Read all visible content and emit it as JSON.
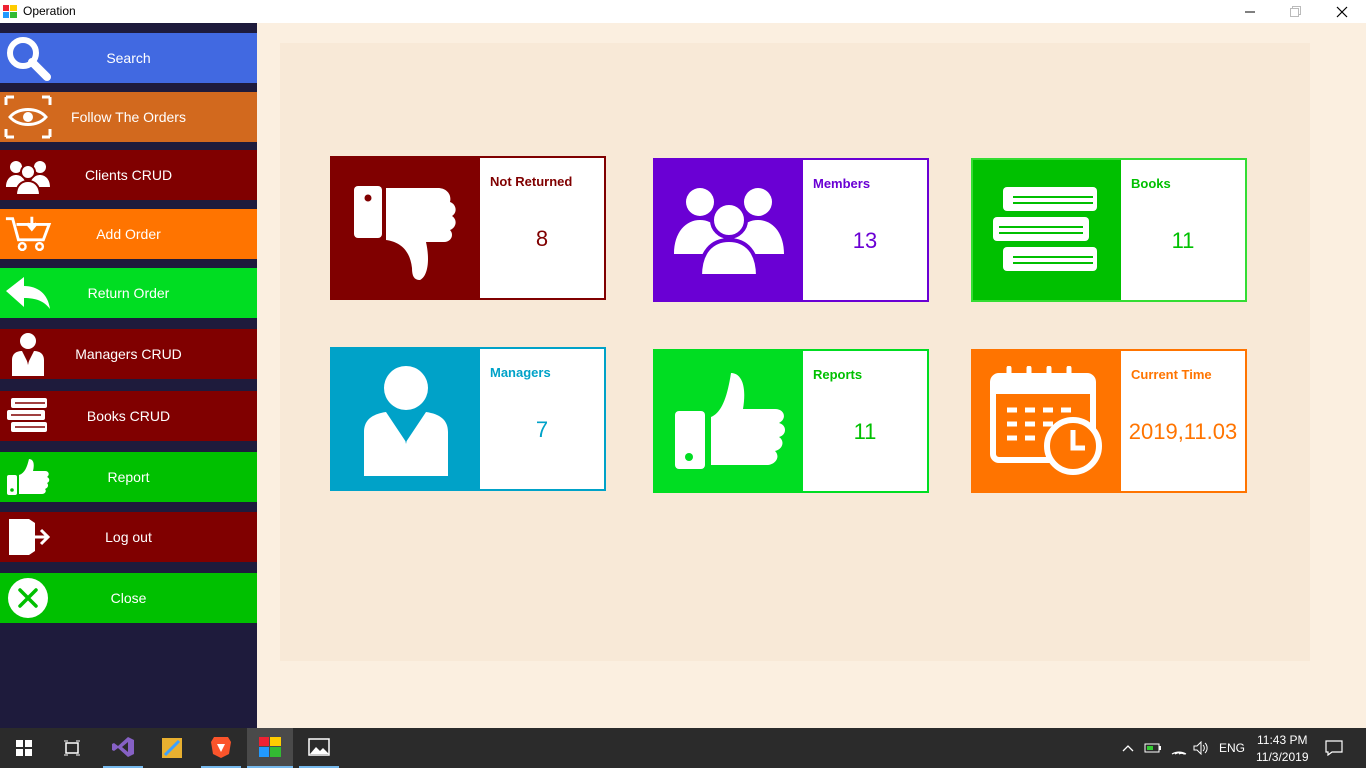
{
  "window": {
    "title": "Operation"
  },
  "sidebar": {
    "items": [
      {
        "label": "Search",
        "icon": "search-icon",
        "color": "#4169e1"
      },
      {
        "label": "Follow The Orders",
        "icon": "eye-icon",
        "color": "#d2691e"
      },
      {
        "label": "Clients CRUD",
        "icon": "users-icon",
        "color": "#800000"
      },
      {
        "label": "Add Order",
        "icon": "cart-icon",
        "color": "#ff7400"
      },
      {
        "label": "Return Order",
        "icon": "return-arrow-icon",
        "color": "#00dd22"
      },
      {
        "label": "Managers CRUD",
        "icon": "manager-icon",
        "color": "#800000"
      },
      {
        "label": "Books CRUD",
        "icon": "books-icon",
        "color": "#800000"
      },
      {
        "label": "Report",
        "icon": "thumbs-up-icon",
        "color": "#00c000"
      },
      {
        "label": "Log out",
        "icon": "logout-icon",
        "color": "#800000"
      },
      {
        "label": "Close",
        "icon": "close-circle-icon",
        "color": "#00c000"
      }
    ]
  },
  "cards": [
    {
      "name": "Not Returned",
      "value": "8",
      "icon": "thumbs-down-icon",
      "color": "#800000"
    },
    {
      "name": "Members",
      "value": "13",
      "icon": "group-icon",
      "color": "#6a00d4"
    },
    {
      "name": "Books",
      "value": "11",
      "icon": "books-stack-icon",
      "color": "#00c000"
    },
    {
      "name": "Managers",
      "value": "7",
      "icon": "manager-icon",
      "color": "#00a2c8"
    },
    {
      "name": "Reports",
      "value": "11",
      "icon": "thumbs-up-icon",
      "color": "#00dd22"
    },
    {
      "name": "Current Time",
      "value": "2019,11.03",
      "icon": "calendar-clock-icon",
      "color": "#ff7400"
    }
  ],
  "taskbar": {
    "time": "11:43 PM",
    "date": "11/3/2019",
    "language": "ENG"
  }
}
